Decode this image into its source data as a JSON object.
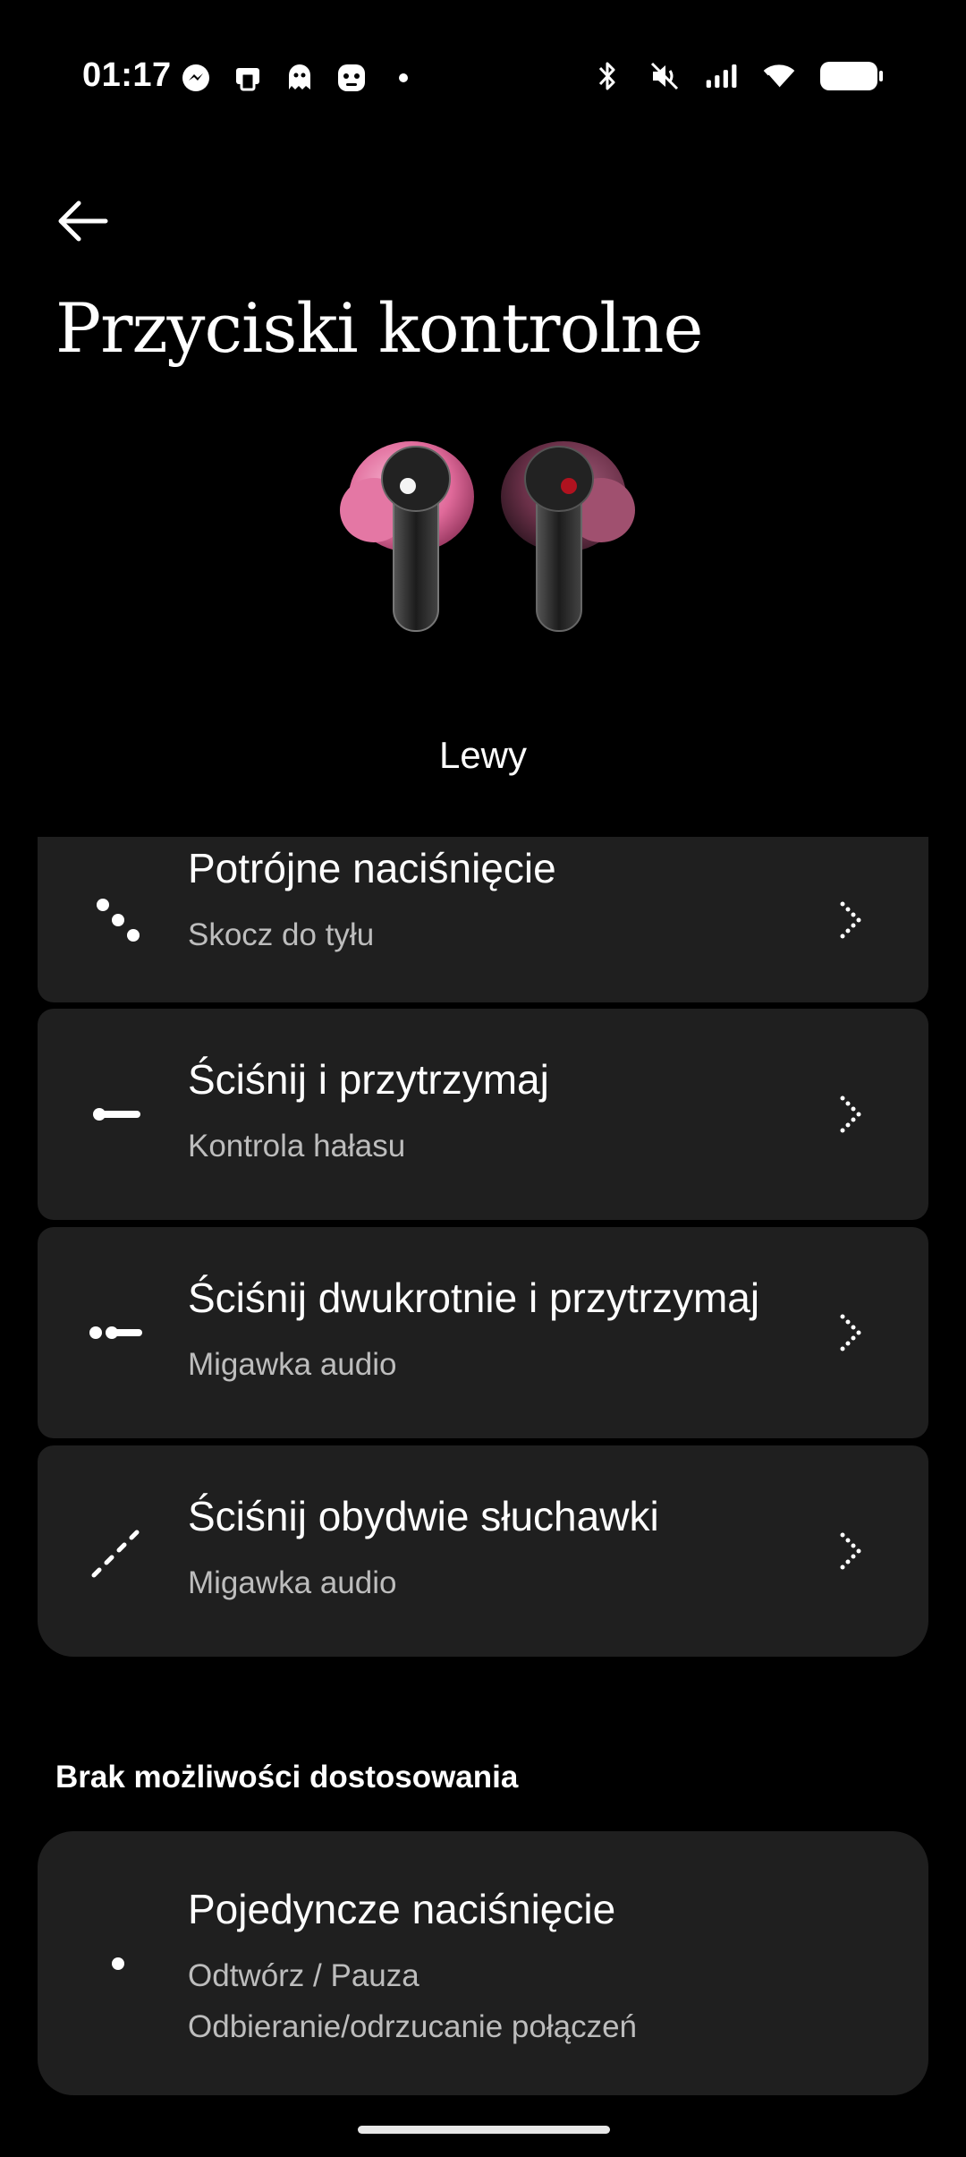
{
  "status_bar": {
    "time": "01:17",
    "left_icons": [
      "messenger-icon",
      "app-icon",
      "ghost-icon",
      "face-icon",
      "dot-icon"
    ],
    "right_icons": [
      "bluetooth-icon",
      "mute-icon",
      "signal-icon",
      "wifi-icon",
      "battery-icon"
    ]
  },
  "header": {
    "title": "Przyciski kontrolne"
  },
  "device": {
    "side_label": "Lewy",
    "image": "earbuds-image"
  },
  "controls": [
    {
      "title": "Potrójne naciśnięcie",
      "subtitle": "Skocz do tyłu",
      "icon": "triple-press-icon"
    },
    {
      "title": "Ściśnij i przytrzymaj",
      "subtitle": "Kontrola hałasu",
      "icon": "press-hold-icon"
    },
    {
      "title": "Ściśnij dwukrotnie i przytrzymaj",
      "subtitle": "Migawka audio",
      "icon": "double-press-hold-icon"
    },
    {
      "title": "Ściśnij obydwie słuchawki",
      "subtitle": "Migawka audio",
      "icon": "both-earbuds-icon"
    }
  ],
  "non_customizable": {
    "heading": "Brak możliwości dostosowania",
    "item": {
      "title": "Pojedyncze naciśnięcie",
      "line1": "Odtwórz / Pauza",
      "line2": "Odbieranie/odrzucanie połączeń",
      "icon": "single-press-icon"
    }
  },
  "colors": {
    "background": "#000000",
    "card": "#1f1f1f",
    "text": "#ffffff",
    "subtext": "#bdbdbd"
  }
}
